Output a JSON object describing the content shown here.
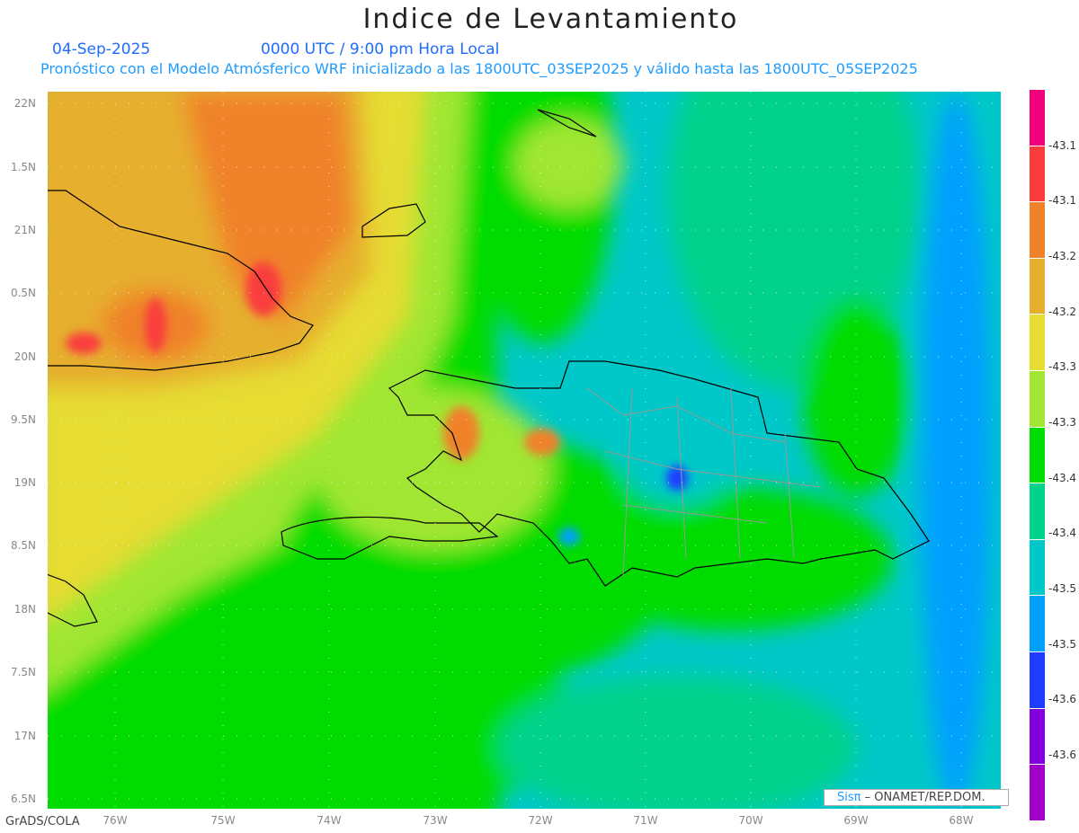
{
  "header": {
    "title": "Indice de Levantamiento",
    "date": "04-Sep-2025",
    "time": "0000 UTC / 9:00 pm Hora Local",
    "subtitle": "Pronóstico con el Modelo Atmósferico WRF inicializado a las 1800UTC_03SEP2025 y válido hasta las  1800UTC_05SEP2025"
  },
  "axes": {
    "y_labels": [
      "22N",
      "1.5N",
      "21N",
      "0.5N",
      "20N",
      "9.5N",
      "19N",
      "8.5N",
      "18N",
      "7.5N",
      "17N",
      "6.5N"
    ],
    "x_labels": [
      "76W",
      "75W",
      "74W",
      "73W",
      "72W",
      "71W",
      "70W",
      "69W",
      "68W"
    ]
  },
  "colorbar": {
    "colors": [
      "#f0007a",
      "#fa3c3c",
      "#f0822a",
      "#e6af2d",
      "#e6dc32",
      "#a0e632",
      "#00dc00",
      "#00d28c",
      "#00c8c8",
      "#00a0ff",
      "#1e3cff",
      "#8200dc",
      "#a000c8"
    ],
    "labels": [
      "-43.1",
      "-43.1",
      "-43.2",
      "-43.2",
      "-43.3",
      "-43.3",
      "-43.4",
      "-43.4",
      "-43.5",
      "-43.5",
      "-43.6",
      "-43.6"
    ]
  },
  "footer": {
    "logo_sis": "Sisπ",
    "logo_text": " – ONAMET/REP.DOM.",
    "credit": "GrADS/COLA"
  }
}
